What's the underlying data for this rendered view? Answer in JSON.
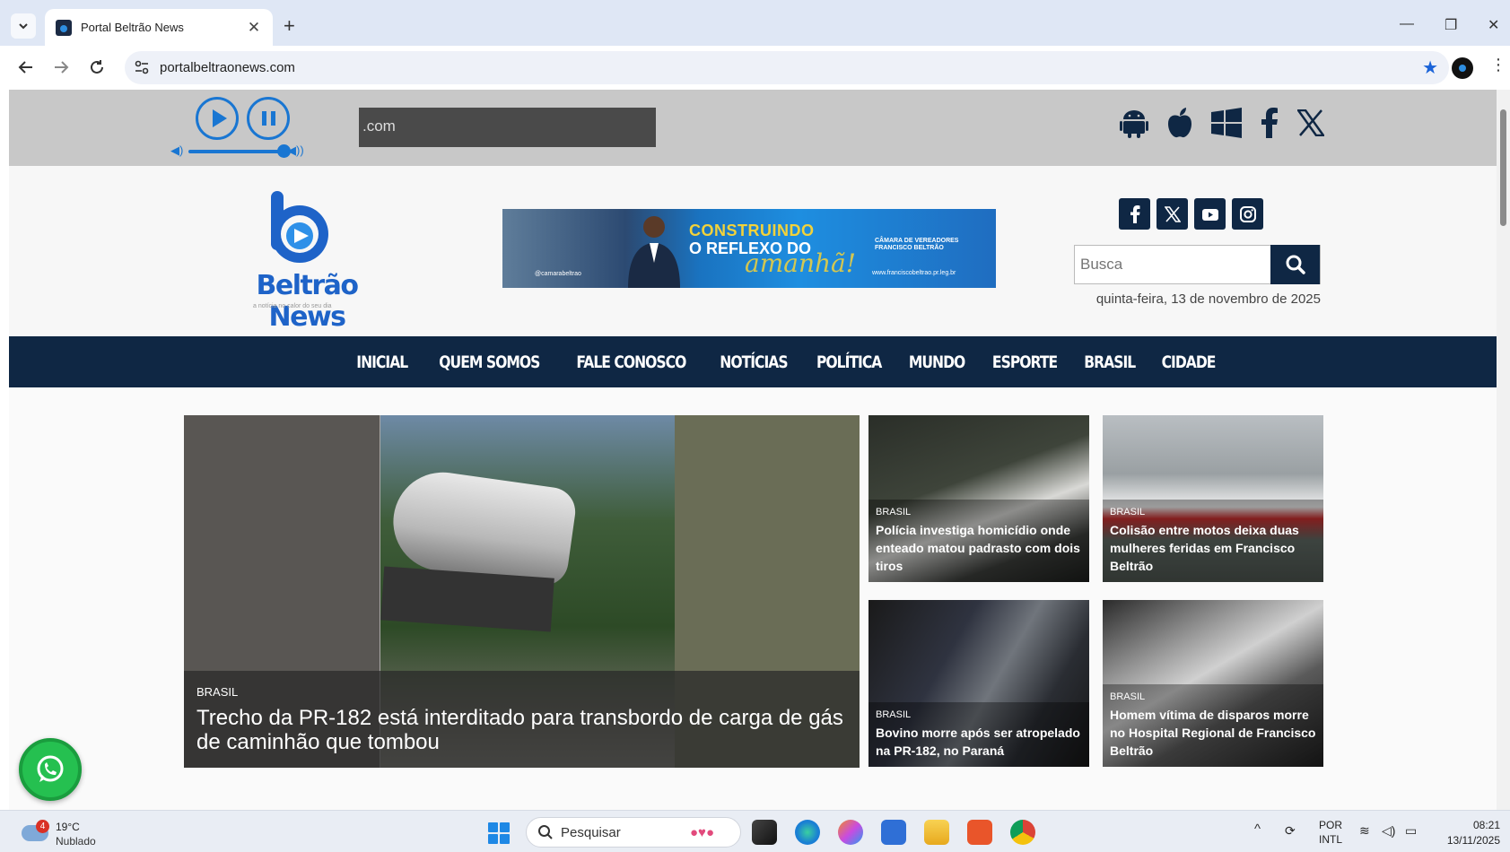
{
  "browser": {
    "tab_title": "Portal Beltrão News",
    "url": "portalbeltraonews.com"
  },
  "site": {
    "ticker_text": ".com",
    "logo_text": "Beltrão News",
    "logo_tagline": "a notícia no calor do seu dia",
    "banner": {
      "line1": "CONSTRUINDO",
      "line2": "O REFLEXO DO",
      "line3": "amanhã!",
      "institution": "CÂMARA DE VEREADORES FRANCISCO BELTRÃO",
      "handle": "@camarabeltrao",
      "url": "www.franciscobeltrao.pr.leg.br"
    },
    "search_placeholder": "Busca",
    "date": "quinta-feira, 13 de novembro de 2025",
    "nav": [
      "INICIAL",
      "QUEM SOMOS",
      "FALE CONOSCO",
      "NOTÍCIAS",
      "POLÍTICA",
      "MUNDO",
      "ESPORTE",
      "BRASIL",
      "CIDADE"
    ]
  },
  "hero": {
    "category": "BRASIL",
    "title": "Trecho da PR-182 está interditado para transbordo de carga de gás de caminhão que tombou"
  },
  "cards": [
    {
      "category": "BRASIL",
      "title": "Polícia investiga homicídio onde enteado matou padrasto com dois tiros"
    },
    {
      "category": "BRASIL",
      "title": "Colisão entre motos deixa duas mulheres feridas em Francisco Beltrão"
    },
    {
      "category": "BRASIL",
      "title": "Bovino morre após ser atropelado na PR-182, no Paraná"
    },
    {
      "category": "BRASIL",
      "title": "Homem vítima de disparos morre no Hospital Regional de Francisco Beltrão"
    }
  ],
  "taskbar": {
    "weather_badge": "4",
    "temperature": "19°C",
    "condition": "Nublado",
    "search_label": "Pesquisar",
    "lang_top": "POR",
    "lang_bottom": "INTL",
    "time": "08:21",
    "date": "13/11/2025"
  }
}
